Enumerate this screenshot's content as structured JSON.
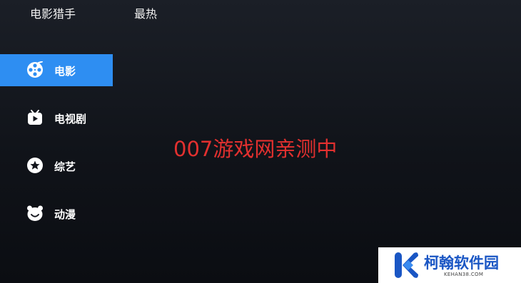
{
  "header": {
    "app_title": "电影猎手",
    "tab_label": "最热"
  },
  "sidebar": {
    "items": [
      {
        "label": "电影",
        "icon": "film-reel-icon",
        "active": true
      },
      {
        "label": "电视剧",
        "icon": "tv-icon",
        "active": false
      },
      {
        "label": "综艺",
        "icon": "star-icon",
        "active": false
      },
      {
        "label": "动漫",
        "icon": "bear-face-icon",
        "active": false
      }
    ]
  },
  "main": {
    "message": "007游戏网亲测中"
  },
  "watermark": {
    "name": "柯翰软件园",
    "url": "KEHAN38.COM"
  },
  "colors": {
    "active_item": "#2e8ef2",
    "message_text": "#e2302f",
    "logo_blue": "#1a56c4"
  }
}
